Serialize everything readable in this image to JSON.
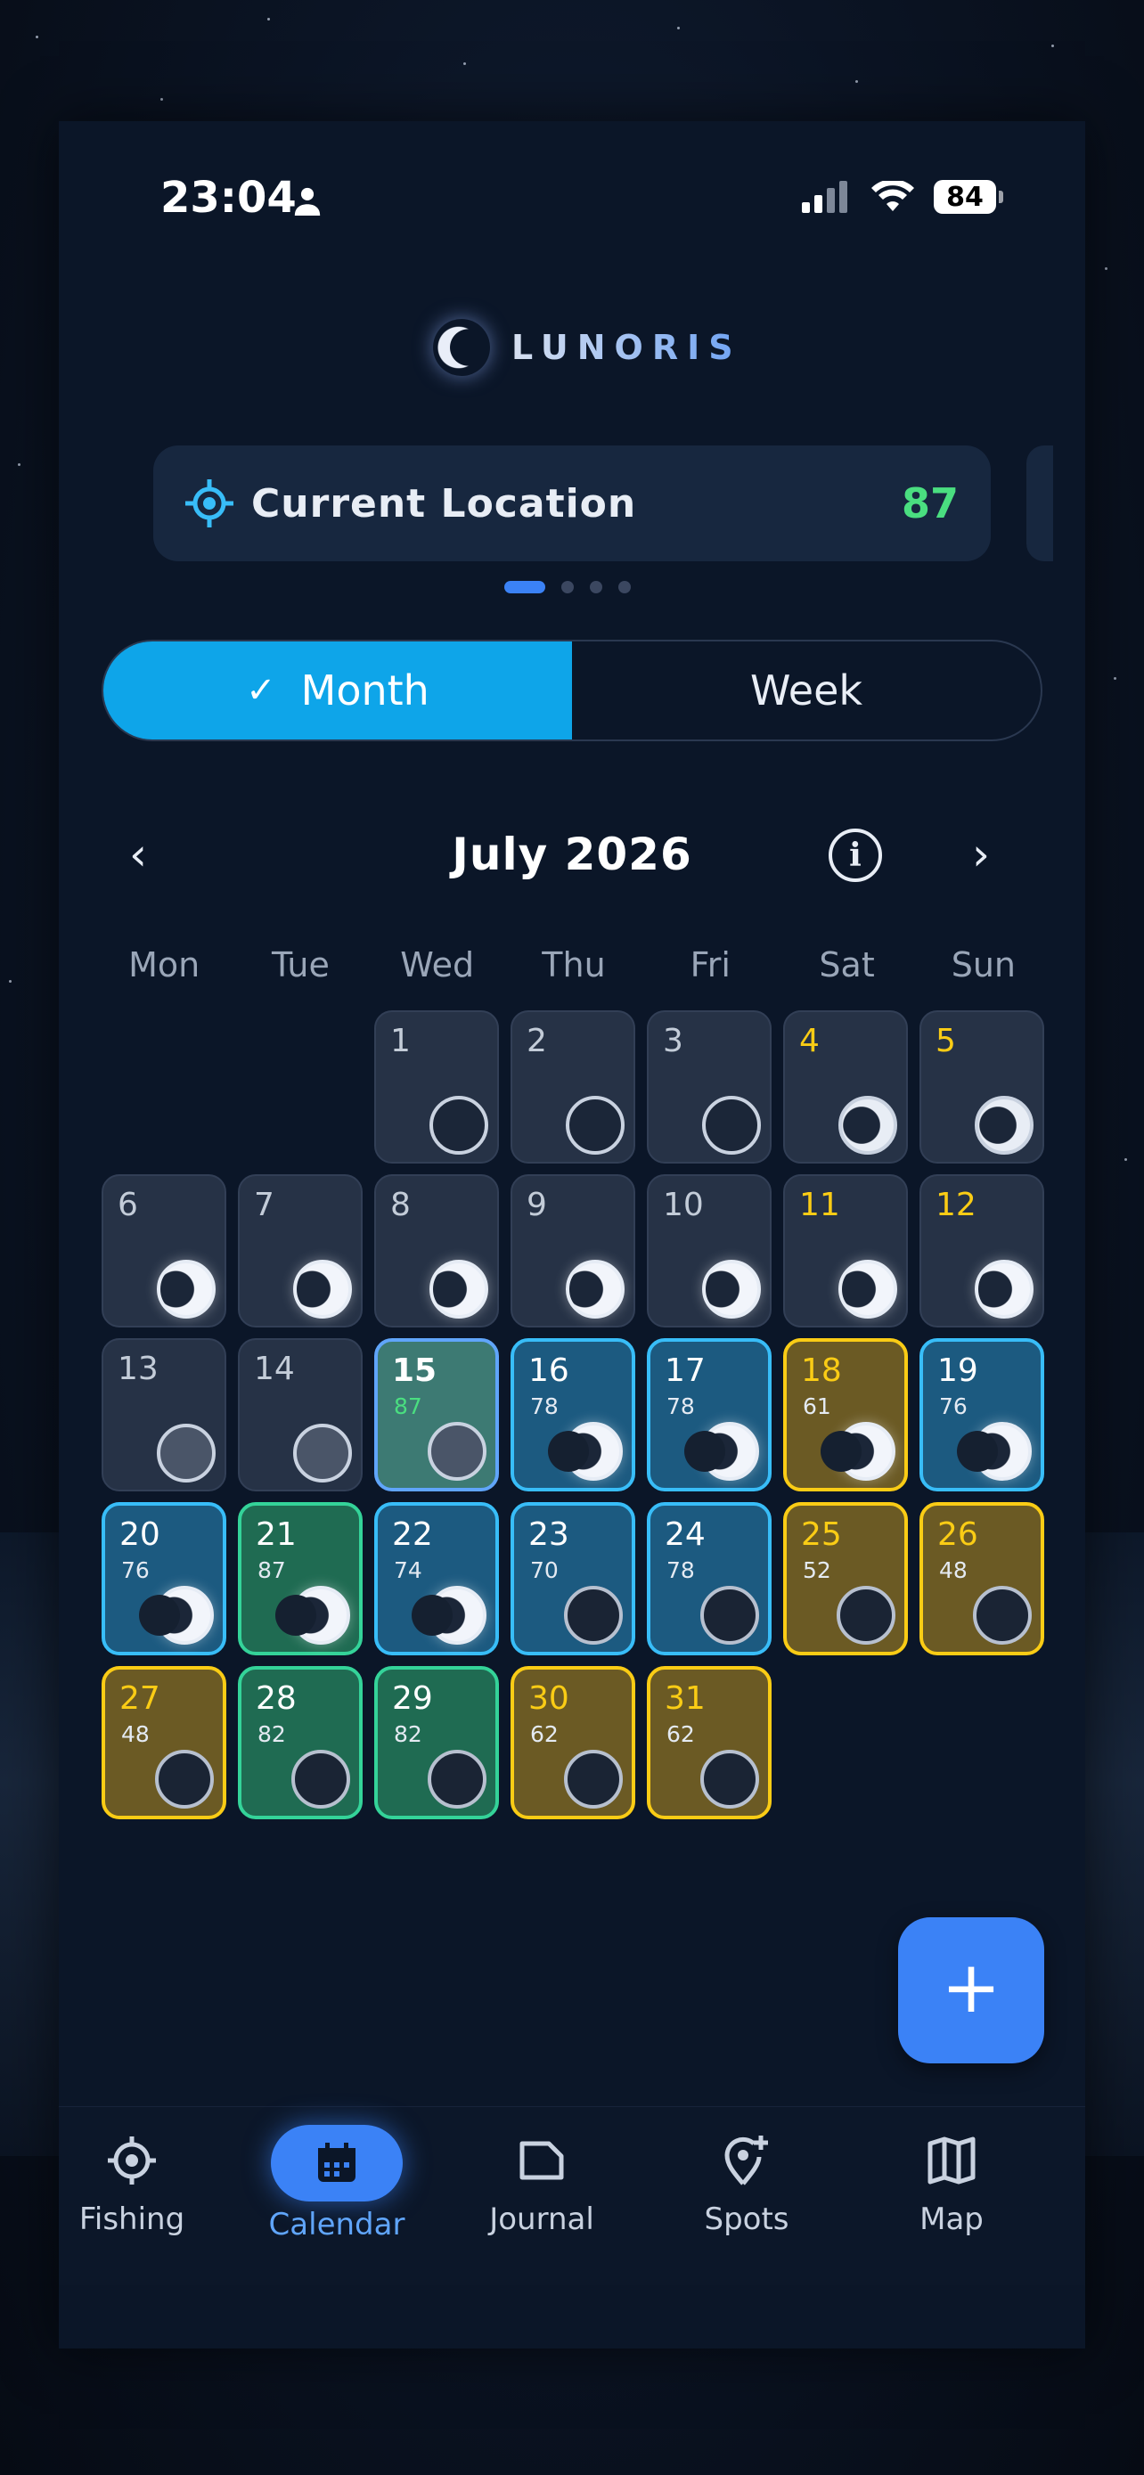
{
  "status": {
    "time": "23:04",
    "battery": "84"
  },
  "app": {
    "name": "LUNORIS"
  },
  "location": {
    "label": "Current Location",
    "score": "87"
  },
  "view_toggle": {
    "month": "Month",
    "week": "Week",
    "selected": "Month"
  },
  "calendar": {
    "title": "July 2026",
    "weekdays": [
      "Mon",
      "Tue",
      "Wed",
      "Thu",
      "Fri",
      "Sat",
      "Sun"
    ],
    "leading_blanks": 2,
    "days": [
      {
        "day": "1",
        "score": "",
        "state": "past",
        "moon": "new"
      },
      {
        "day": "2",
        "score": "",
        "state": "past",
        "moon": "new"
      },
      {
        "day": "3",
        "score": "",
        "state": "past",
        "moon": "new"
      },
      {
        "day": "4",
        "score": "",
        "state": "past",
        "moon": "waning",
        "weekend": true
      },
      {
        "day": "5",
        "score": "",
        "state": "past",
        "moon": "waning",
        "weekend": true
      },
      {
        "day": "6",
        "score": "",
        "state": "past",
        "moon": "bright"
      },
      {
        "day": "7",
        "score": "",
        "state": "past",
        "moon": "bright"
      },
      {
        "day": "8",
        "score": "",
        "state": "past",
        "moon": "bright"
      },
      {
        "day": "9",
        "score": "",
        "state": "past",
        "moon": "bright"
      },
      {
        "day": "10",
        "score": "",
        "state": "past",
        "moon": "bright"
      },
      {
        "day": "11",
        "score": "",
        "state": "past",
        "moon": "bright",
        "weekend": true
      },
      {
        "day": "12",
        "score": "",
        "state": "past",
        "moon": "bright",
        "weekend": true
      },
      {
        "day": "13",
        "score": "",
        "state": "past",
        "moon": "newdim"
      },
      {
        "day": "14",
        "score": "",
        "state": "past",
        "moon": "newdim"
      },
      {
        "day": "15",
        "score": "87",
        "state": "today",
        "moon": "newdim"
      },
      {
        "day": "16",
        "score": "78",
        "state": "blue",
        "moon": "bright"
      },
      {
        "day": "17",
        "score": "78",
        "state": "blue",
        "moon": "bright"
      },
      {
        "day": "18",
        "score": "61",
        "state": "yellow",
        "moon": "bright"
      },
      {
        "day": "19",
        "score": "76",
        "state": "blue",
        "moon": "bright"
      },
      {
        "day": "20",
        "score": "76",
        "state": "blue",
        "moon": "bright"
      },
      {
        "day": "21",
        "score": "87",
        "state": "green",
        "moon": "bright"
      },
      {
        "day": "22",
        "score": "74",
        "state": "blue",
        "moon": "bright"
      },
      {
        "day": "23",
        "score": "70",
        "state": "blue",
        "moon": "dark"
      },
      {
        "day": "24",
        "score": "78",
        "state": "blue",
        "moon": "dark"
      },
      {
        "day": "25",
        "score": "52",
        "state": "yellow",
        "moon": "dark"
      },
      {
        "day": "26",
        "score": "48",
        "state": "yellow",
        "moon": "dark"
      },
      {
        "day": "27",
        "score": "48",
        "state": "yellow",
        "moon": "dark"
      },
      {
        "day": "28",
        "score": "82",
        "state": "green",
        "moon": "dark"
      },
      {
        "day": "29",
        "score": "82",
        "state": "green",
        "moon": "dark"
      },
      {
        "day": "30",
        "score": "62",
        "state": "yellow",
        "moon": "dark"
      },
      {
        "day": "31",
        "score": "62",
        "state": "yellow",
        "moon": "dark"
      }
    ]
  },
  "fab": {
    "label": "+"
  },
  "nav": [
    {
      "id": "fishing",
      "label": "Fishing",
      "icon": "target-icon"
    },
    {
      "id": "calendar",
      "label": "Calendar",
      "icon": "calendar-icon",
      "active": true
    },
    {
      "id": "journal",
      "label": "Journal",
      "icon": "folder-icon"
    },
    {
      "id": "spots",
      "label": "Spots",
      "icon": "pin-plus-icon"
    },
    {
      "id": "map",
      "label": "Map",
      "icon": "map-icon"
    }
  ],
  "colors": {
    "accent": "#0ea5e9",
    "primary": "#3b82f6",
    "good": "#4ade80",
    "weekend": "#facc15"
  }
}
